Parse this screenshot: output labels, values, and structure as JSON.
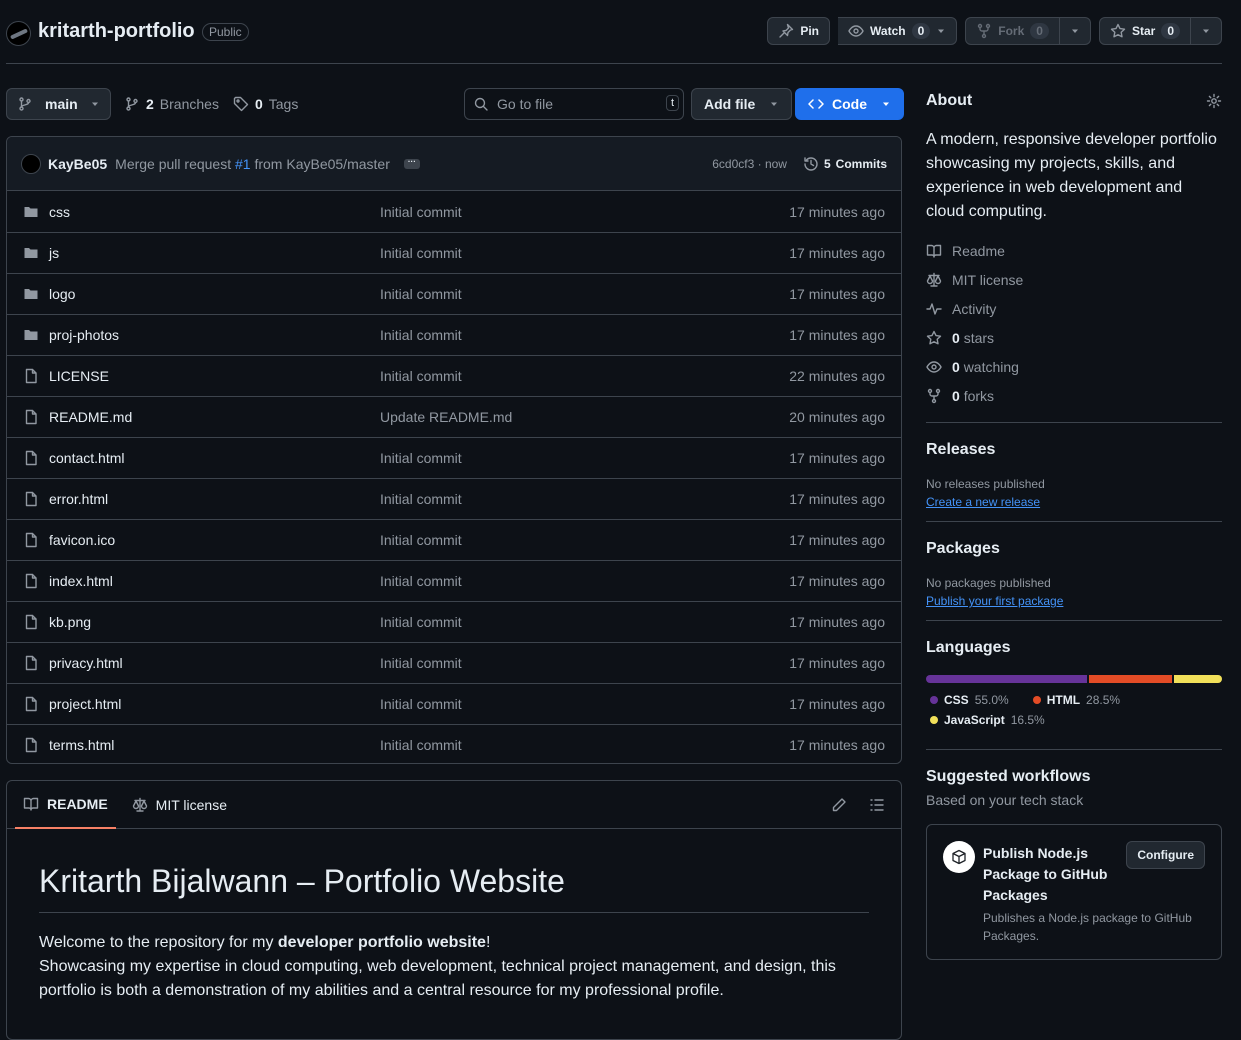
{
  "header": {
    "repo_name": "kritarth-portfolio",
    "visibility": "Public",
    "pin_label": "Pin",
    "watch_label": "Watch",
    "watch_count": "0",
    "fork_label": "Fork",
    "fork_count": "0",
    "star_label": "Star",
    "star_count": "0"
  },
  "toolbar": {
    "branch": "main",
    "branches_count": "2",
    "branches_label": "Branches",
    "tags_count": "0",
    "tags_label": "Tags",
    "search_placeholder": "Go to file",
    "search_kbd": "t",
    "add_file_label": "Add file",
    "code_label": "Code"
  },
  "commit": {
    "author": "KayBe05",
    "message_before": "Merge pull request",
    "pr": "#1",
    "message_after": "from KayBe05/master",
    "sha_time": "6cd0cf3 · now",
    "commits_count": "5",
    "commits_label": "Commits"
  },
  "files": [
    {
      "type": "dir",
      "name": "css",
      "message": "Initial commit",
      "date": "17 minutes ago"
    },
    {
      "type": "dir",
      "name": "js",
      "message": "Initial commit",
      "date": "17 minutes ago"
    },
    {
      "type": "dir",
      "name": "logo",
      "message": "Initial commit",
      "date": "17 minutes ago"
    },
    {
      "type": "dir",
      "name": "proj-photos",
      "message": "Initial commit",
      "date": "17 minutes ago"
    },
    {
      "type": "file",
      "name": "LICENSE",
      "message": "Initial commit",
      "date": "22 minutes ago"
    },
    {
      "type": "file",
      "name": "README.md",
      "message": "Update README.md",
      "date": "20 minutes ago"
    },
    {
      "type": "file",
      "name": "contact.html",
      "message": "Initial commit",
      "date": "17 minutes ago"
    },
    {
      "type": "file",
      "name": "error.html",
      "message": "Initial commit",
      "date": "17 minutes ago"
    },
    {
      "type": "file",
      "name": "favicon.ico",
      "message": "Initial commit",
      "date": "17 minutes ago"
    },
    {
      "type": "file",
      "name": "index.html",
      "message": "Initial commit",
      "date": "17 minutes ago"
    },
    {
      "type": "file",
      "name": "kb.png",
      "message": "Initial commit",
      "date": "17 minutes ago"
    },
    {
      "type": "file",
      "name": "privacy.html",
      "message": "Initial commit",
      "date": "17 minutes ago"
    },
    {
      "type": "file",
      "name": "project.html",
      "message": "Initial commit",
      "date": "17 minutes ago"
    },
    {
      "type": "file",
      "name": "terms.html",
      "message": "Initial commit",
      "date": "17 minutes ago"
    }
  ],
  "readme": {
    "tab_readme": "README",
    "tab_license": "MIT license",
    "title": "Kritarth Bijalwann – Portfolio Website",
    "p1_before": "Welcome to the repository for my ",
    "p1_bold": "developer portfolio website",
    "p1_after": "!",
    "p2": "Showcasing my expertise in cloud computing, web development, technical project management, and design, this portfolio is both a demonstration of my abilities and a central resource for my professional profile."
  },
  "about": {
    "title": "About",
    "description": "A modern, responsive developer portfolio showcasing my projects, skills, and experience in web development and cloud computing.",
    "readme": "Readme",
    "license": "MIT license",
    "activity": "Activity",
    "stars_count": "0",
    "stars_label": "stars",
    "watching_count": "0",
    "watching_label": "watching",
    "forks_count": "0",
    "forks_label": "forks"
  },
  "releases": {
    "title": "Releases",
    "empty": "No releases published",
    "link": "Create a new release"
  },
  "packages": {
    "title": "Packages",
    "empty": "No packages published",
    "link": "Publish your first package"
  },
  "languages": {
    "title": "Languages",
    "items": [
      {
        "name": "CSS",
        "percent": "55.0%",
        "value": 55.0,
        "color": "#663399"
      },
      {
        "name": "HTML",
        "percent": "28.5%",
        "value": 28.5,
        "color": "#e34c26"
      },
      {
        "name": "JavaScript",
        "percent": "16.5%",
        "value": 16.5,
        "color": "#f1e05a"
      }
    ]
  },
  "workflows": {
    "title": "Suggested workflows",
    "subtitle": "Based on your tech stack",
    "card_title": "Publish Node.js Package to GitHub Packages",
    "card_desc": "Publishes a Node.js package to GitHub Packages.",
    "configure": "Configure"
  }
}
